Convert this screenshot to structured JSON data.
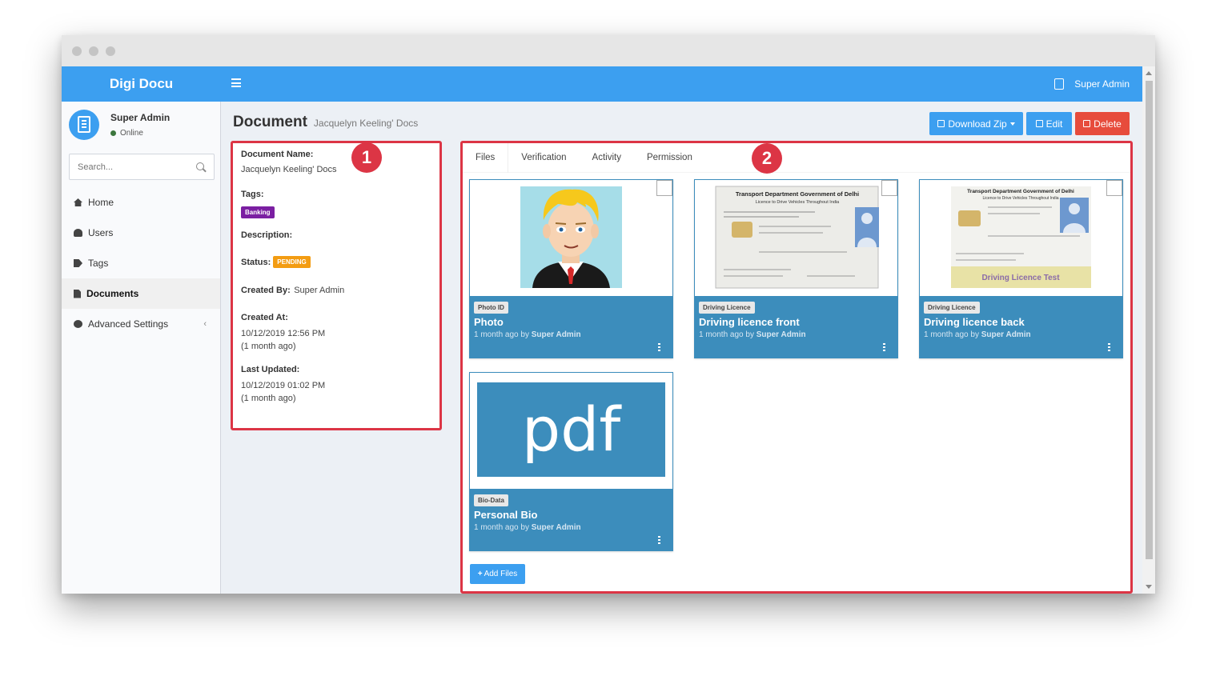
{
  "app": {
    "brand": "Digi Docu"
  },
  "header": {
    "user_name": "Super Admin"
  },
  "sidebar": {
    "user": {
      "name": "Super Admin",
      "status": "Online"
    },
    "search": {
      "placeholder": "Search..."
    },
    "items": [
      {
        "label": "Home",
        "icon": "home-icon"
      },
      {
        "label": "Users",
        "icon": "users-icon"
      },
      {
        "label": "Tags",
        "icon": "tags-icon"
      },
      {
        "label": "Documents",
        "icon": "file-icon",
        "active": true
      },
      {
        "label": "Advanced Settings",
        "icon": "info-circle-icon",
        "chevron": "‹"
      }
    ]
  },
  "page": {
    "title": "Document",
    "subtitle": "Jacquelyn Keeling' Docs",
    "buttons": {
      "download": "Download Zip",
      "edit": "Edit",
      "delete": "Delete"
    }
  },
  "details": {
    "name_label": "Document Name:",
    "name_value": "Jacquelyn Keeling' Docs",
    "tags_label": "Tags:",
    "tag": "Banking",
    "description_label": "Description:",
    "status_label": "Status:",
    "status_value": "PENDING",
    "created_by_label": "Created By:",
    "created_by_value": "Super Admin",
    "created_at_label": "Created At:",
    "created_at_value": "10/12/2019 12:56 PM",
    "created_at_relative": "(1 month ago)",
    "updated_label": "Last Updated:",
    "updated_value": "10/12/2019 01:02 PM",
    "updated_relative": "(1 month ago)"
  },
  "markers": [
    "1",
    "2"
  ],
  "tabs": [
    "Files",
    "Verification",
    "Activity",
    "Permission"
  ],
  "files": [
    {
      "tag": "Photo ID",
      "title": "Photo",
      "time": "1 month ago",
      "by_word": "by",
      "author": "Super Admin"
    },
    {
      "tag": "Driving Licence",
      "title": "Driving licence front",
      "time": "1 month ago",
      "by_word": "by",
      "author": "Super Admin",
      "thumb_title": "Transport Department Government of Delhi",
      "thumb_sub": "Licence to Drive Vehicles Throughout India"
    },
    {
      "tag": "Driving Licence",
      "title": "Driving licence back",
      "time": "1 month ago",
      "by_word": "by",
      "author": "Super Admin",
      "thumb_title": "Transport Department Government of Delhi",
      "thumb_sub": "Licence to Drive Vehicles Throughout India",
      "thumb_banner": "Driving Licence Test"
    },
    {
      "tag": "Bio-Data",
      "title": "Personal Bio",
      "time": "1 month ago",
      "by_word": "by",
      "author": "Super Admin",
      "thumb_text": "pdf"
    }
  ],
  "add_files": "Add Files",
  "colors": {
    "primary": "#3c9ff0",
    "card": "#3c8dbc",
    "danger": "#e74c3c",
    "tag_purple": "#7b1fa2",
    "pending": "#f39c12"
  }
}
